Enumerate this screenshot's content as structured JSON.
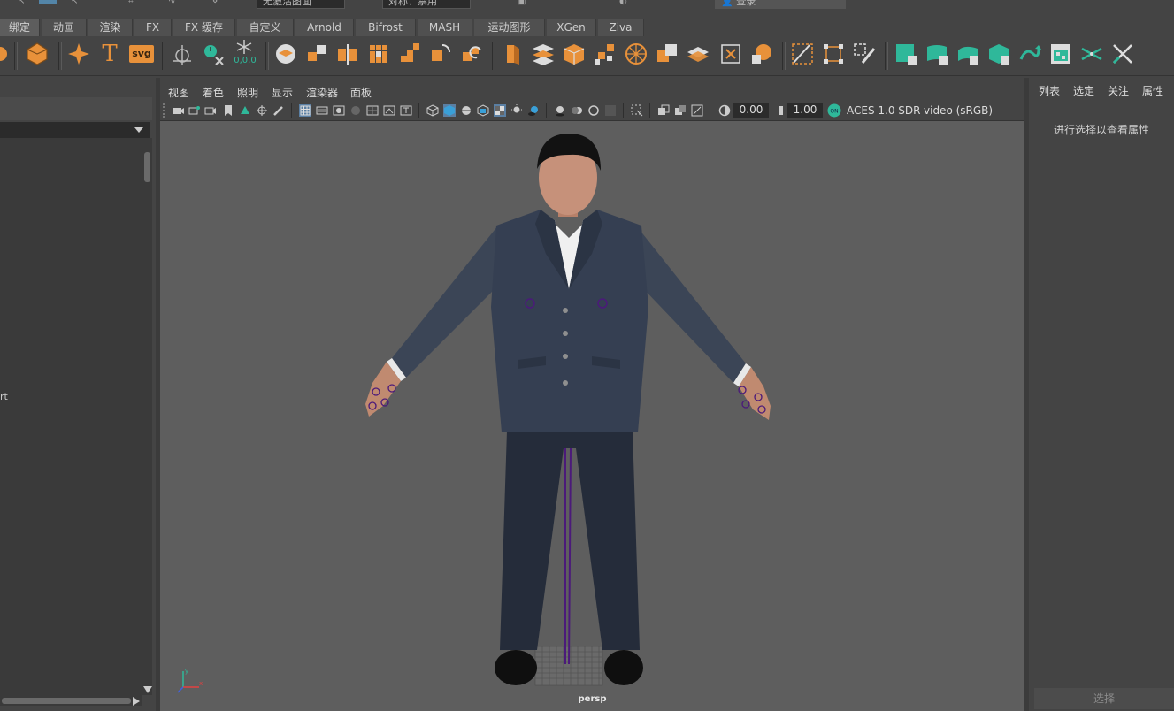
{
  "top_strip": {
    "field1": "无激活图面",
    "field2": "对称：禁用",
    "login": "登录"
  },
  "shelf_tabs": [
    "绑定",
    "动画",
    "渲染",
    "FX",
    "FX 缓存",
    "自定义",
    "Arnold",
    "Bifrost",
    "MASH",
    "运动图形",
    "XGen",
    "Ziva"
  ],
  "shelf_icons": {
    "text_icon": "T",
    "svg_icon": "svg",
    "origin_label": "0,0,0"
  },
  "viewport": {
    "menu": [
      "视图",
      "着色",
      "照明",
      "显示",
      "渲染器",
      "面板"
    ],
    "exposure": "0.00",
    "gamma": "1.00",
    "color_space": "ACES 1.0 SDR-video (sRGB)",
    "camera": "persp"
  },
  "left_panel": {
    "fragment": "rt"
  },
  "attribute_editor": {
    "tabs": [
      "列表",
      "选定",
      "关注",
      "属性"
    ],
    "hint": "进行选择以查看属性",
    "select_button": "选择"
  },
  "colors": {
    "accent_orange": "#e8913a",
    "accent_teal": "#2fb89a",
    "viewport_bg": "#5e5e5e",
    "panel_bg": "#444444"
  }
}
